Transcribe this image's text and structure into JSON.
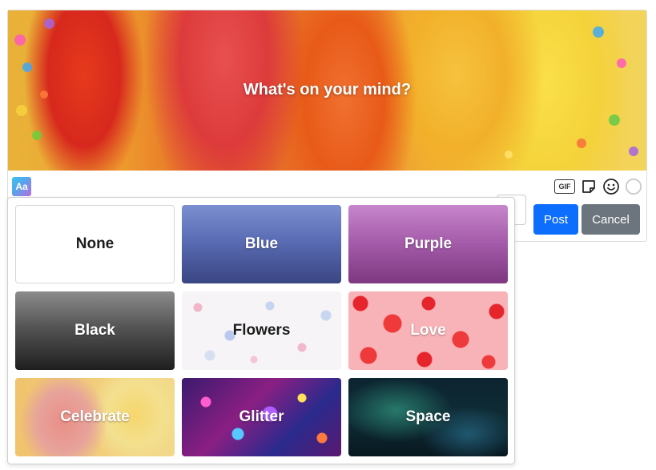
{
  "composer": {
    "prompt": "What's on your mind?",
    "text_style_button": "Aa",
    "tools": {
      "gif_label": "GIF",
      "icons": [
        "gif-icon",
        "sticky-note-icon",
        "smiley-icon",
        "circle-icon"
      ]
    },
    "actions": {
      "post_label": "Post",
      "cancel_label": "Cancel"
    }
  },
  "background_picker": {
    "options": [
      {
        "label": "None"
      },
      {
        "label": "Blue"
      },
      {
        "label": "Purple"
      },
      {
        "label": "Black"
      },
      {
        "label": "Flowers"
      },
      {
        "label": "Love"
      },
      {
        "label": "Celebrate"
      },
      {
        "label": "Glitter"
      },
      {
        "label": "Space"
      }
    ]
  },
  "colors": {
    "post_button": "#0d6efd",
    "cancel_button": "#6c757d"
  }
}
